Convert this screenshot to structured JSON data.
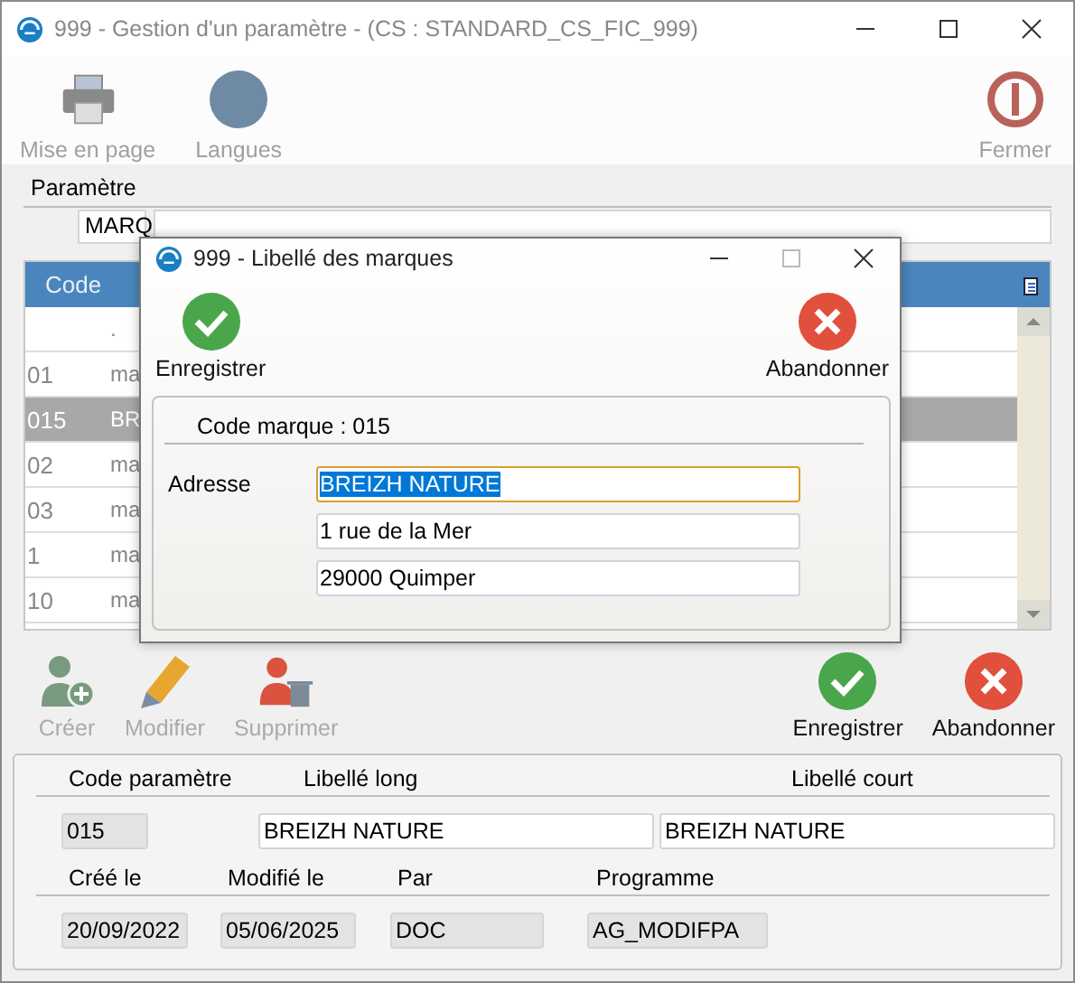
{
  "window": {
    "title": "999 - Gestion d'un paramètre - (CS : STANDARD_CS_FIC_999)"
  },
  "toolbar": [
    {
      "label": "Mise en page",
      "kind": "printer"
    },
    {
      "label": "Langues",
      "kind": "globe"
    },
    {
      "label": "Fermer",
      "kind": "power"
    }
  ],
  "parametre": {
    "label": "Paramètre",
    "code": "MARQ"
  },
  "table": {
    "columns": [
      "Code"
    ],
    "rows": [
      {
        "code": "",
        "column_2": ".",
        "selected": false
      },
      {
        "code": "01",
        "column_2": "ma",
        "selected": false
      },
      {
        "code": "015",
        "column_2": "BR",
        "selected": true
      },
      {
        "code": "02",
        "column_2": "ma",
        "selected": false
      },
      {
        "code": "03",
        "column_2": "ma",
        "selected": false
      },
      {
        "code": "1",
        "column_2": "ma",
        "selected": false
      },
      {
        "code": "10",
        "column_2": "ma",
        "selected": false
      }
    ]
  },
  "actions": [
    {
      "label": "Créer",
      "kind": "create",
      "disabled": true
    },
    {
      "label": "Modifier",
      "kind": "edit",
      "disabled": true
    },
    {
      "label": "Supprimer",
      "kind": "delete",
      "disabled": true
    },
    {
      "label": "Enregistrer",
      "kind": "save",
      "disabled": false
    },
    {
      "label": "Abandonner",
      "kind": "cancel",
      "disabled": false
    }
  ],
  "detail": {
    "code_label": "Code paramètre",
    "long_label": "Libellé long",
    "short_label": "Libellé court",
    "code": "015",
    "long": "BREIZH NATURE",
    "short": "BREIZH NATURE",
    "created_label": "Créé le",
    "modified_label": "Modifié le",
    "by_label": "Par",
    "program_label": "Programme",
    "created": "20/09/2022",
    "modified": "05/06/2025",
    "by": "DOC",
    "program": "AG_MODIFPA"
  },
  "dialog": {
    "title": "999 - Libellé des marques",
    "buttons": [
      {
        "label": "Enregistrer",
        "kind": "save"
      },
      {
        "label": "Abandonner",
        "kind": "cancel"
      }
    ],
    "heading": "Code marque : 015",
    "address_label": "Adresse",
    "address_lines": [
      {
        "value": "BREIZH NATURE",
        "selected": true
      },
      {
        "value": "1 rue de la Mer",
        "selected": false
      },
      {
        "value": "29000 Quimper",
        "selected": false
      }
    ]
  }
}
